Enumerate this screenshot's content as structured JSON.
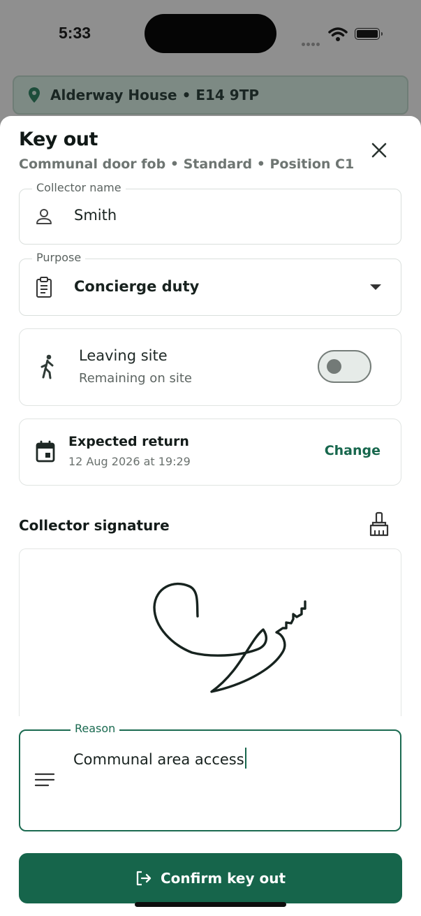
{
  "status_bar": {
    "time": "5:33"
  },
  "location_banner": {
    "text": "Alderway House • E14 9TP",
    "icon": "location-pin-icon"
  },
  "sheet": {
    "title": "Key out",
    "subtitle": "Communal door fob • Standard • Position C1",
    "collector": {
      "legend": "Collector name",
      "value": "Smith",
      "icon": "person-icon"
    },
    "purpose": {
      "legend": "Purpose",
      "value": "Concierge duty",
      "icon": "clipboard-icon"
    },
    "leaving": {
      "label": "Leaving site",
      "state_text": "Remaining on site",
      "toggle_on": false,
      "icon": "walking-person-icon"
    },
    "expected_return": {
      "label": "Expected return",
      "value": "12 Aug 2026 at 19:29",
      "action": "Change",
      "icon": "calendar-icon"
    },
    "signature": {
      "heading": "Collector signature",
      "clear_icon": "broom-icon"
    },
    "reason": {
      "legend": "Reason",
      "value": "Communal area access",
      "icon": "notes-icon"
    },
    "confirm_label": "Confirm key out"
  },
  "colors": {
    "accent": "#16654b",
    "scrim": "#8f8f8f",
    "banner": "#7d8a84"
  }
}
